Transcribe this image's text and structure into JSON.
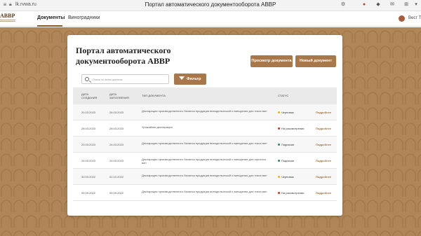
{
  "browser": {
    "url": "lk.rvwa.ru",
    "document_title": "Портал автоматического документооборота АВВР"
  },
  "header": {
    "logo_text": "АВВР",
    "tabs": [
      {
        "label": "Документы",
        "active": true
      },
      {
        "label": "Виноградники",
        "active": false
      }
    ],
    "user_name": "Вест Те"
  },
  "colors": {
    "accent": "#a9784a",
    "background": "#b08658",
    "status_draft": "#e6b422",
    "status_pending": "#c0392b",
    "status_signed": "#2e8b57"
  },
  "card": {
    "title": "Портал автоматического документооборота АВВР",
    "view_button": "Просмотр документа",
    "new_button": "Новый документ"
  },
  "search": {
    "placeholder": "Поиск по всем данным"
  },
  "filter": {
    "label": "Фильтр",
    "icon": "filter-icon"
  },
  "table": {
    "headers": {
      "created": "Дата создания",
      "filled": "Дата заполнения",
      "type": "Тип документа",
      "status": "Статус"
    },
    "details_label": "Подробнее",
    "rows": [
      {
        "created": "20.03.2023",
        "filled": "28.03.2023",
        "type": "Декларация производственного баланса продукции винодельческой и виноделия для тихих вин",
        "status": "Черновик",
        "status_color": "#e6b422"
      },
      {
        "created": "28.03.2023",
        "filled": "28.03.2023",
        "type": "Урожайная декларация",
        "status": "На рассмотрении",
        "status_color": "#c0392b"
      },
      {
        "created": "20.03.2023",
        "filled": "24.03.2023",
        "type": "Декларация производственного баланса продукции винодельческой и виноделия для тихих вин",
        "status": "Подписан",
        "status_color": "#2e8b57"
      },
      {
        "created": "24.03.2023",
        "filled": "24.03.2023",
        "type": "Декларация производственного баланса продукции винодельческой и виноделия для игристых вин",
        "status": "Подписан",
        "status_color": "#2e8b57"
      },
      {
        "created": "30.03.2022",
        "filled": "02.10.2022",
        "type": "Декларация производственного баланса продукции винодельческой и виноделия для тихих вин",
        "status": "Черновик",
        "status_color": "#e6b422"
      },
      {
        "created": "09.09.2022",
        "filled": "09.09.2022",
        "type": "Декларация производственного баланса продукции винодельческой и виноделия для тихих вин",
        "status": "На рассмотрении",
        "status_color": "#c0392b"
      }
    ]
  }
}
